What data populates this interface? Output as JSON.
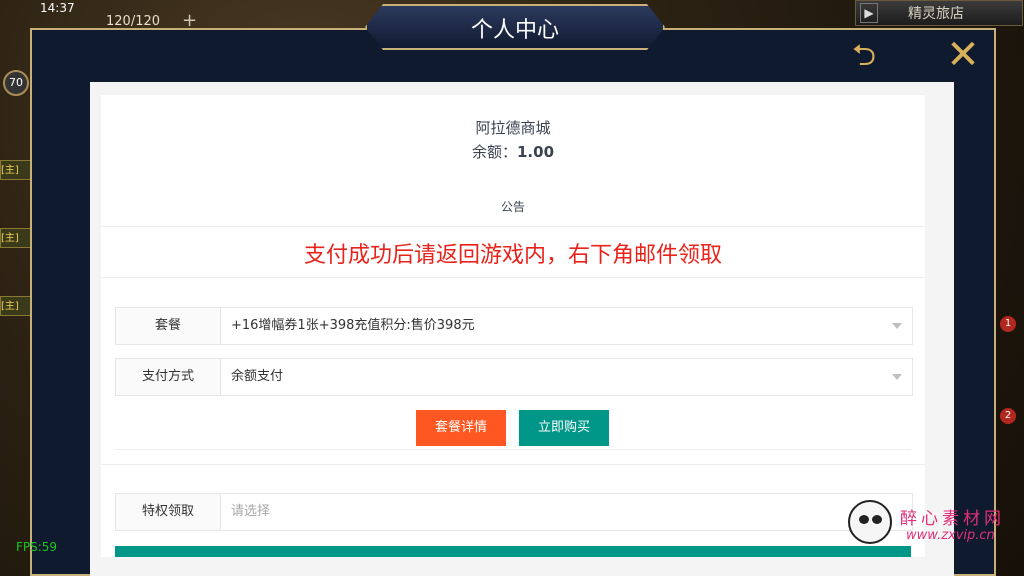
{
  "hud": {
    "time": "14:37",
    "energy": "120/120",
    "plus": "+",
    "level": "70",
    "shop_label": "精灵旅店",
    "chip_label": "[主]",
    "badge_1": "1",
    "badge_2": "2",
    "fps": "FPS:59"
  },
  "modal": {
    "title": "个人中心",
    "back_icon": "return-arrow-icon",
    "close_icon": "close-x-icon"
  },
  "store": {
    "name": "阿拉德商城",
    "balance_label": "余额：",
    "balance_value": "1.00",
    "notice_title": "公告",
    "notice_text": "支付成功后请返回游戏内，右下角邮件领取"
  },
  "form": {
    "package_label": "套餐",
    "package_value": "+16增幅券1张+398充值积分:售价398元",
    "payment_label": "支付方式",
    "payment_value": "余额支付",
    "privilege_label": "特权领取",
    "privilege_placeholder": "请选择"
  },
  "buttons": {
    "detail": "套餐详情",
    "buy": "立即购买"
  },
  "watermark": {
    "line1": "醉心素材网",
    "line2": "www.zxvip.cn"
  },
  "colors": {
    "notice_red": "#e8231b",
    "detail_orange": "#ff5722",
    "buy_teal": "#009688",
    "frame_gold": "#c8b079"
  }
}
